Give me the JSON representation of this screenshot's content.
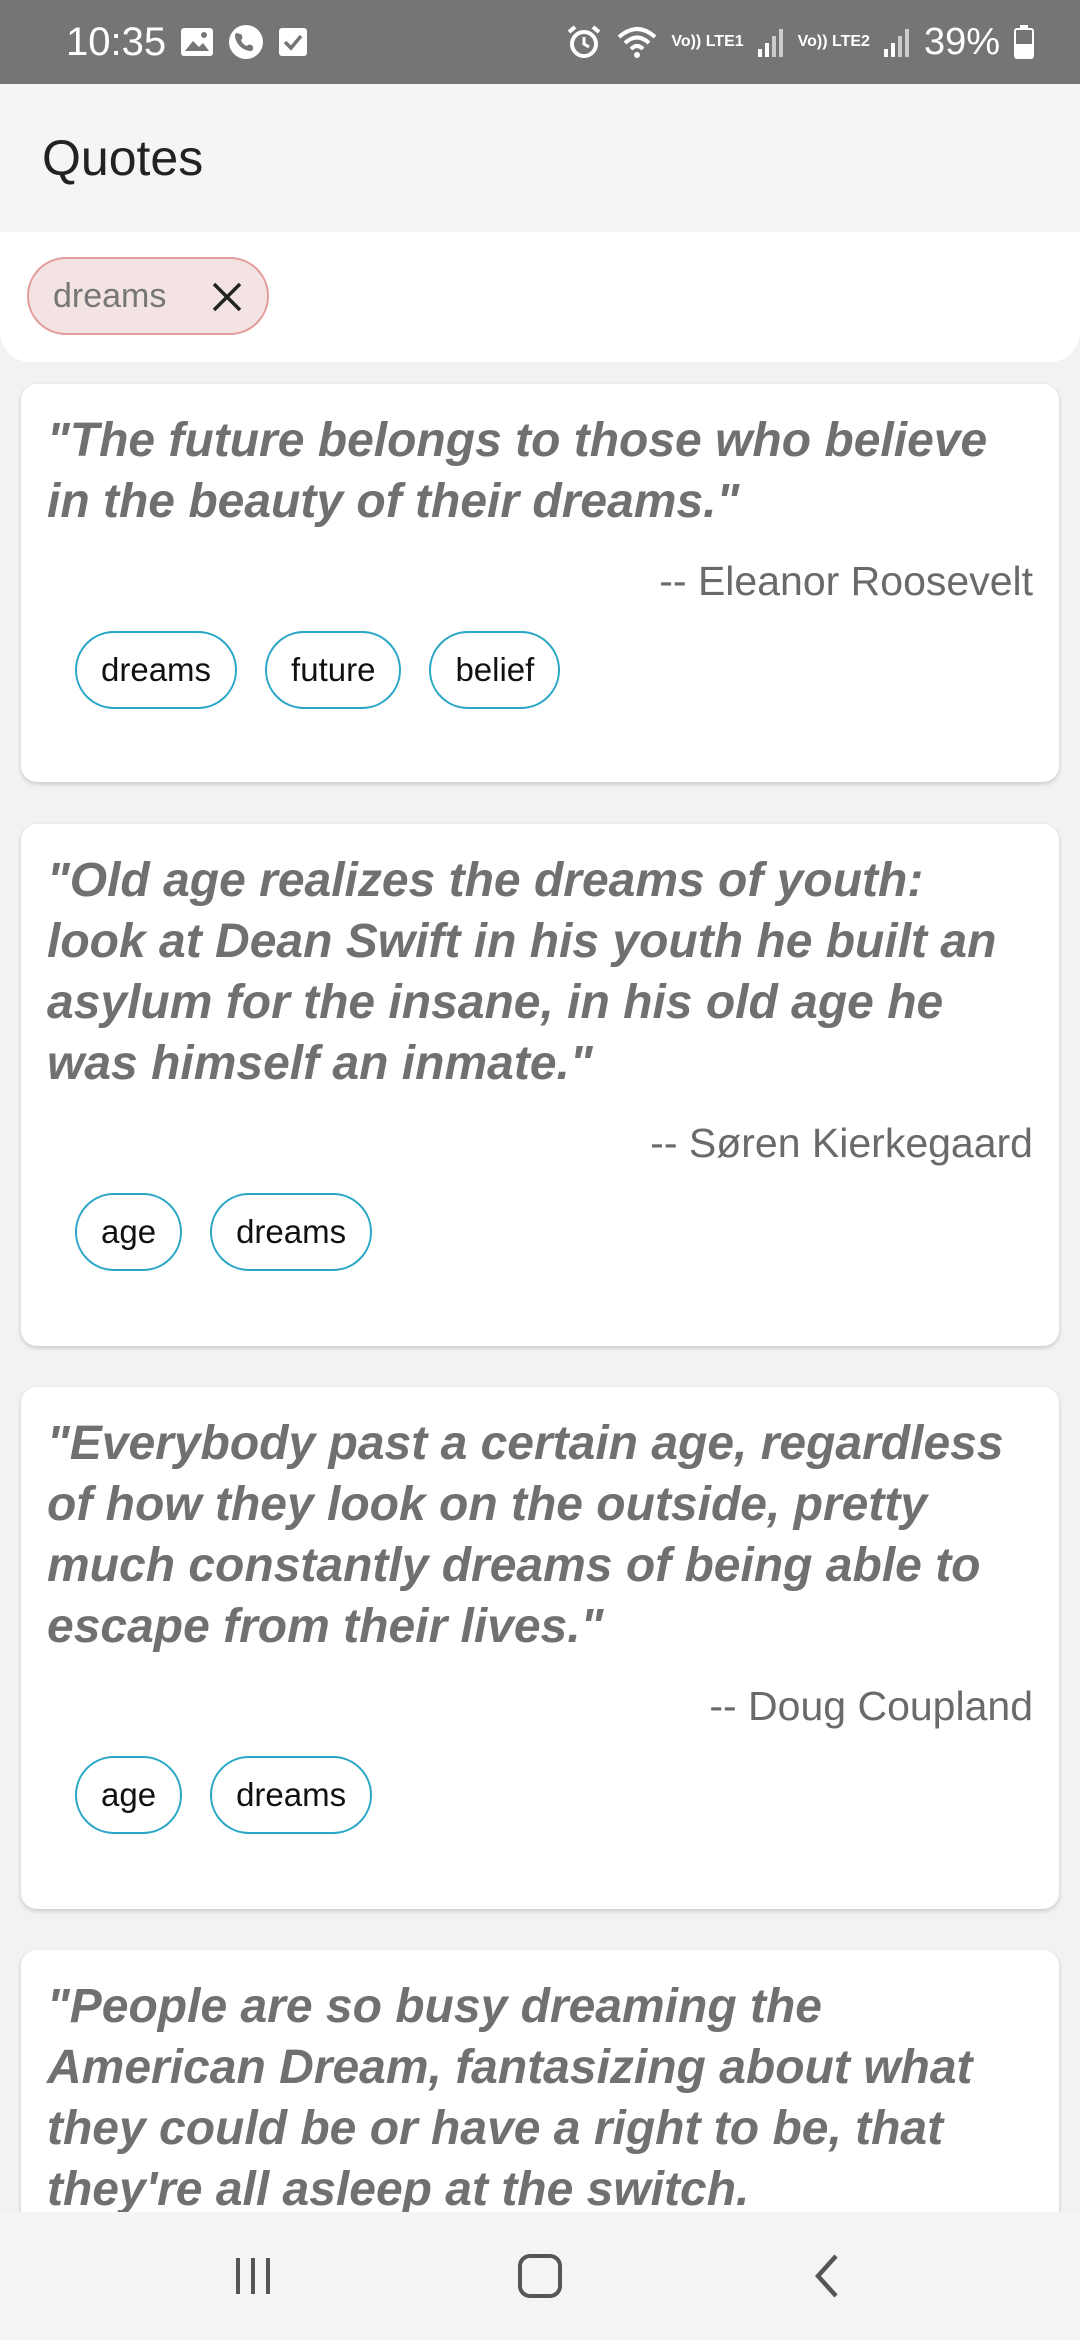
{
  "status_bar": {
    "time": "10:35",
    "network1": "Vo)) LTE1",
    "network2": "Vo)) LTE2",
    "battery": "39%",
    "icons": [
      "gallery-icon",
      "phone-icon",
      "check-box-icon",
      "alarm-icon",
      "wifi-icon",
      "signal-icon",
      "battery-icon"
    ]
  },
  "app_bar": {
    "title": "Quotes"
  },
  "filter": {
    "chip_label": "dreams"
  },
  "quotes": [
    {
      "text": "\"The future belongs to those who believe in the beauty of their dreams.\"",
      "author": "-- Eleanor Roosevelt",
      "tags": [
        "dreams",
        "future",
        "belief"
      ]
    },
    {
      "text": "\"Old age realizes the dreams of youth: look at Dean Swift in his youth he built an asylum for the insane, in his old age he was himself an inmate.\"",
      "author": "-- Søren Kierkegaard",
      "tags": [
        "age",
        "dreams"
      ]
    },
    {
      "text": "\"Everybody past a certain age, regardless of how they look on the outside, pretty much constantly dreams of being able to escape from their lives.\"",
      "author": "-- Doug Coupland",
      "tags": [
        "age",
        "dreams"
      ]
    },
    {
      "text": "\"People are so busy dreaming the American Dream, fantasizing about what they could be or have a right to be, that they're all asleep at the switch. Consequently we are",
      "author": "",
      "tags": []
    }
  ],
  "colors": {
    "status_bar": "#757575",
    "chip_border": "#e39b9b",
    "chip_fill": "#f4e3e3",
    "tag_border": "#2aa7c6",
    "quote_text": "#707070"
  }
}
